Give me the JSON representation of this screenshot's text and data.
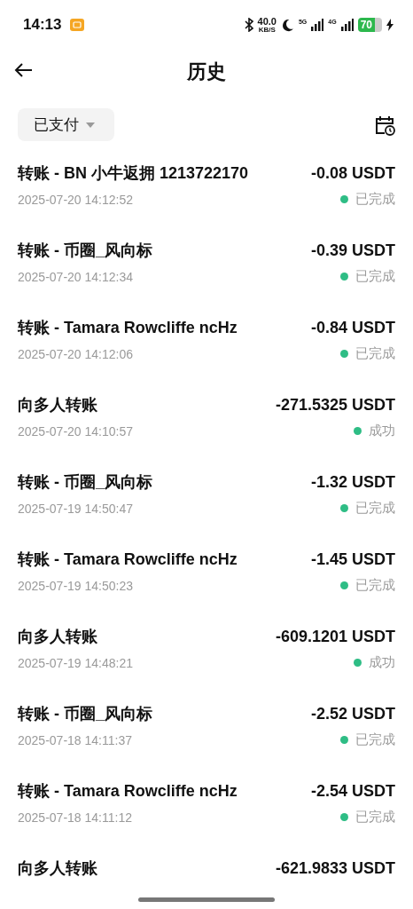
{
  "status_bar": {
    "time": "14:13",
    "speed": "40.0",
    "speed_unit": "KB/S",
    "net_5g": "5G",
    "net_4g": "4G",
    "battery": "70"
  },
  "header": {
    "title": "历史"
  },
  "filter": {
    "label": "已支付"
  },
  "transactions": [
    {
      "title": "转账 - BN 小牛返拥 1213722170",
      "amount": "-0.08 USDT",
      "time": "2025-07-20 14:12:52",
      "status": "已完成"
    },
    {
      "title": "转账 - 币圈_风向标",
      "amount": "-0.39 USDT",
      "time": "2025-07-20 14:12:34",
      "status": "已完成"
    },
    {
      "title": "转账 - Tamara Rowcliffe ncHz",
      "amount": "-0.84 USDT",
      "time": "2025-07-20 14:12:06",
      "status": "已完成"
    },
    {
      "title": "向多人转账",
      "amount": "-271.5325 USDT",
      "time": "2025-07-20 14:10:57",
      "status": "成功"
    },
    {
      "title": "转账 - 币圈_风向标",
      "amount": "-1.32 USDT",
      "time": "2025-07-19 14:50:47",
      "status": "已完成"
    },
    {
      "title": "转账 - Tamara Rowcliffe ncHz",
      "amount": "-1.45 USDT",
      "time": "2025-07-19 14:50:23",
      "status": "已完成"
    },
    {
      "title": "向多人转账",
      "amount": "-609.1201 USDT",
      "time": "2025-07-19 14:48:21",
      "status": "成功"
    },
    {
      "title": "转账 - 币圈_风向标",
      "amount": "-2.52 USDT",
      "time": "2025-07-18 14:11:37",
      "status": "已完成"
    },
    {
      "title": "转账 - Tamara Rowcliffe ncHz",
      "amount": "-2.54 USDT",
      "time": "2025-07-18 14:11:12",
      "status": "已完成"
    },
    {
      "title": "向多人转账",
      "amount": "-621.9833 USDT"
    }
  ]
}
